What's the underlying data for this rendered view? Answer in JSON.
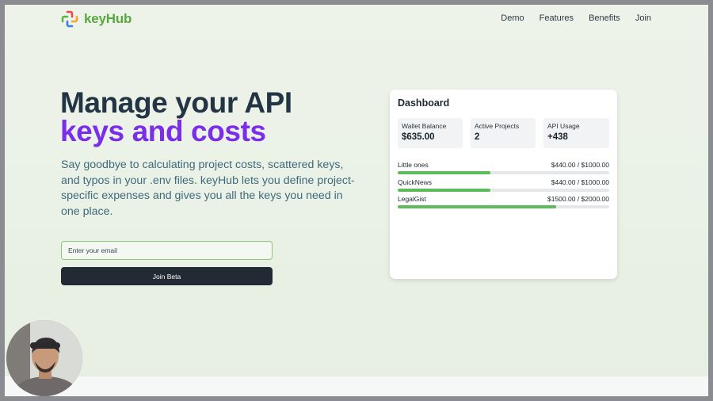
{
  "brand": {
    "name": "keyHub",
    "logo_icon": "plus-knot-logo-icon",
    "color": "#58a83f"
  },
  "nav": {
    "items": [
      "Demo",
      "Features",
      "Benefits",
      "Join"
    ]
  },
  "hero": {
    "title_line1": "Manage your API",
    "title_line2": "keys and costs",
    "description": "Say goodbye to calculating project costs, scattered keys, and typos in your .env files. keyHub lets you define project-specific expenses and gives you all the keys you need in one place.",
    "accent_color": "#7a2ee8"
  },
  "signup": {
    "email_placeholder": "Enter your email",
    "button_label": "Join Beta"
  },
  "dashboard": {
    "title": "Dashboard",
    "stats": [
      {
        "label": "Wallet Balance",
        "value": "$635.00"
      },
      {
        "label": "Active Projects",
        "value": "2"
      },
      {
        "label": "API Usage",
        "value": "+438"
      }
    ],
    "projects": [
      {
        "name": "Little ones",
        "amount": "$440.00 / $1000.00",
        "progress": 0.44
      },
      {
        "name": "QuickNews",
        "amount": "$440.00 / $1000.00",
        "progress": 0.44
      },
      {
        "name": "LegalGist",
        "amount": "$1500.00 / $2000.00",
        "progress": 0.75
      }
    ],
    "bar_color": "#5cbc5a"
  },
  "webcam": {
    "icon": "presenter-webcam-icon"
  }
}
